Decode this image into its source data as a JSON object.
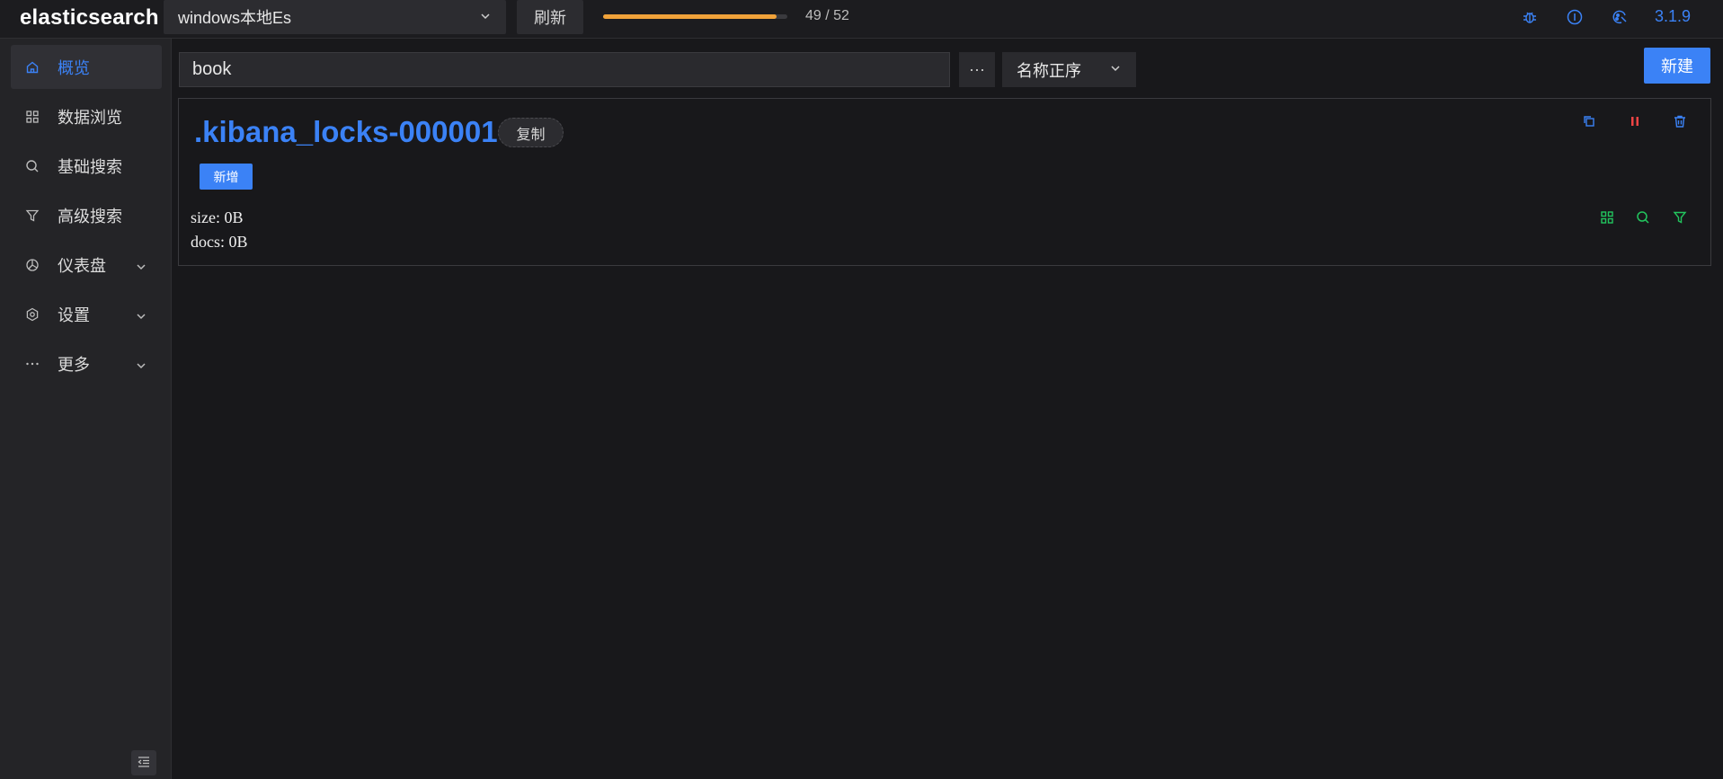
{
  "app": {
    "logo": "elasticsearch",
    "version": "3.1.9"
  },
  "topbar": {
    "cluster_value": "windows本地Es",
    "refresh_label": "刷新",
    "progress_fraction": 0.94,
    "progress_text": "49 / 52",
    "icons": [
      "bug-icon",
      "info-icon",
      "theme-icon"
    ]
  },
  "sidebar": {
    "items": [
      {
        "label": "概览",
        "icon": "home-icon",
        "active": true
      },
      {
        "label": "数据浏览",
        "icon": "grid-icon"
      },
      {
        "label": "基础搜索",
        "icon": "search-icon"
      },
      {
        "label": "高级搜索",
        "icon": "filter-icon"
      },
      {
        "label": "仪表盘",
        "icon": "dashboard-icon",
        "expandable": true
      },
      {
        "label": "设置",
        "icon": "gear-icon",
        "expandable": true
      },
      {
        "label": "更多",
        "icon": "ellipsis-icon",
        "expandable": true
      }
    ]
  },
  "toolbar": {
    "search_value": "book",
    "more_label": "···",
    "sort_value": "名称正序",
    "new_label": "新建"
  },
  "index_card": {
    "name": ".kibana_locks-000001",
    "copy_label": "复制",
    "add_label": "新增",
    "size": "size: 0B",
    "docs": "docs: 0B"
  },
  "colors": {
    "accent": "#3b82f6",
    "progress": "#f0a23a",
    "danger": "#ef4444",
    "success": "#22c55e",
    "background": "#18181b",
    "sidebar": "#242427"
  }
}
